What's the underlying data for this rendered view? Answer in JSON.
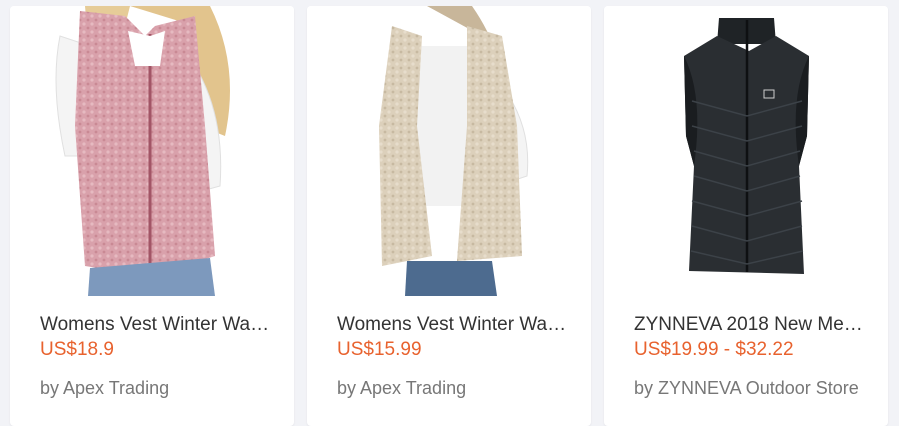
{
  "products": [
    {
      "title": "Womens Vest Winter Warm...",
      "price": "US$18.9",
      "seller": "by Apex Trading",
      "image_icon": "pink-sherpa-vest-photo"
    },
    {
      "title": "Womens Vest Winter Warm...",
      "price": "US$15.99",
      "seller": "by Apex Trading",
      "image_icon": "beige-sherpa-vest-photo"
    },
    {
      "title": "ZYNNEVA 2018 New Men...",
      "price": "US$19.99 - $32.22",
      "seller": "by ZYNNEVA Outdoor Store",
      "image_icon": "black-puffer-vest-photo"
    }
  ],
  "colors": {
    "price": "#e8622e",
    "title": "#333333",
    "seller": "#777777",
    "background": "#f2f3f7"
  }
}
